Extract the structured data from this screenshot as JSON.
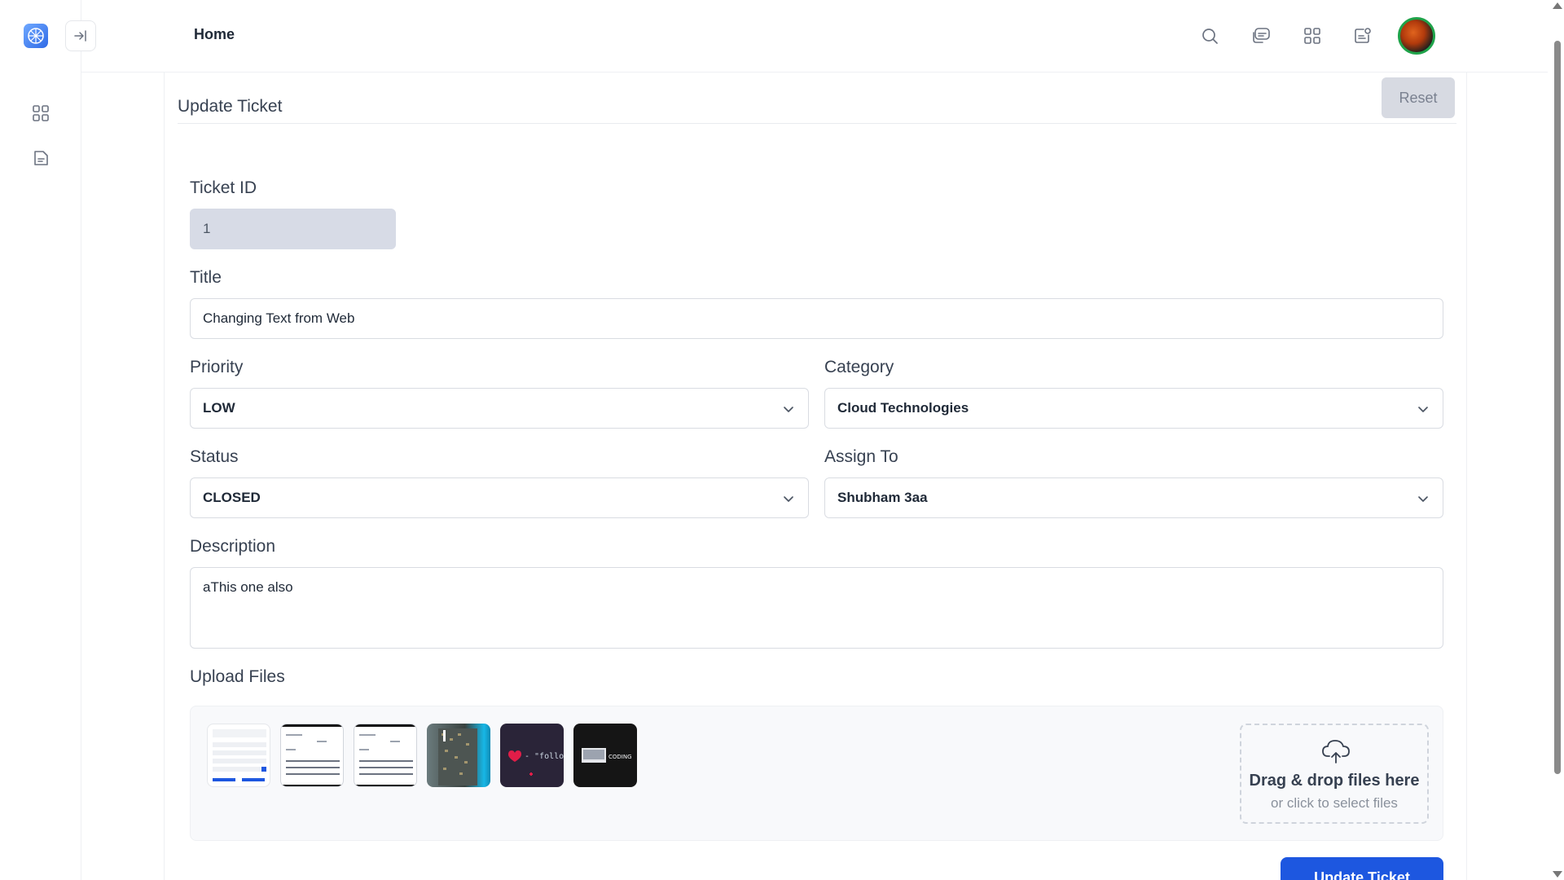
{
  "header": {
    "title": "Home",
    "icons": [
      "search-icon",
      "chat-icon",
      "apps-grid-icon",
      "notifications-icon"
    ]
  },
  "sidebar": {
    "items": [
      {
        "icon": "dashboard-grid-icon"
      },
      {
        "icon": "document-icon"
      }
    ]
  },
  "form": {
    "title": "Update Ticket",
    "reset_label": "Reset",
    "ticket_id_label": "Ticket ID",
    "ticket_id_value": "1",
    "title_label": "Title",
    "title_value": "Changing Text from Web",
    "priority_label": "Priority",
    "priority_value": "LOW",
    "category_label": "Category",
    "category_value": "Cloud Technologies",
    "status_label": "Status",
    "status_value": "CLOSED",
    "assign_label": "Assign To",
    "assign_value": "Shubham 3aa",
    "description_label": "Description",
    "description_value": "aThis one also",
    "upload_label": "Upload Files",
    "dropzone_main": "Drag & drop files here",
    "dropzone_sub": "or click to select files",
    "submit_label": "Update Ticket",
    "thumb_text_4": "- \"follo",
    "thumb_text_5": "CODING"
  },
  "colors": {
    "accent": "#1d57e0",
    "disabled_bg": "#d7dbe6",
    "reset_bg": "#d7dae2"
  }
}
